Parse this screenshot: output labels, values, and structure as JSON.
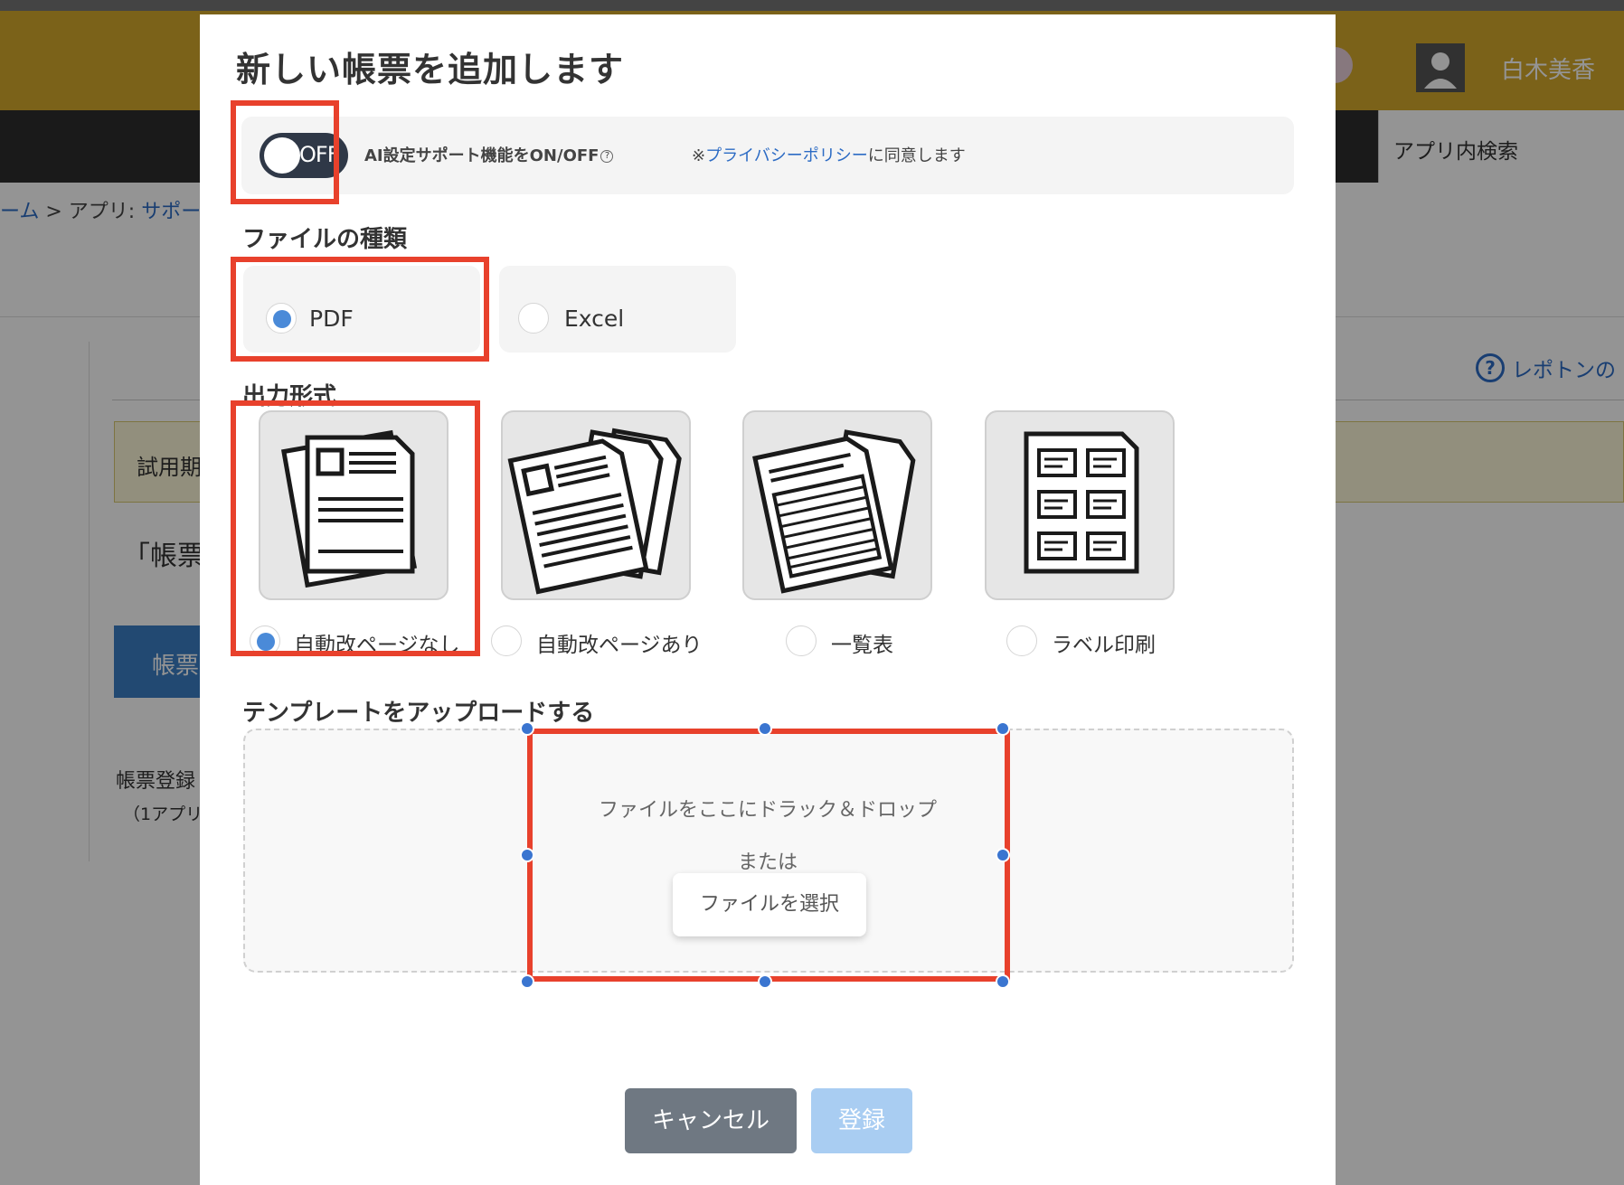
{
  "background": {
    "user_name": "白木美香",
    "search_label": "アプリ内検索",
    "breadcrumb_home": "ーム",
    "breadcrumb_sep": ">",
    "breadcrumb_app": "アプリ:",
    "breadcrumb_app_link": "サポー",
    "trial_text": "試用期",
    "reptone_link": "レポトンの",
    "bracket_text": "「帳票",
    "blue_button": "帳票",
    "reg_text": "帳票登録",
    "reg_sub": "（1アプリ"
  },
  "modal": {
    "title": "新しい帳票を追加します",
    "ai": {
      "toggle_state": "OFF",
      "label": "AI設定サポート機能をON/OFF",
      "help_icon": "?",
      "privacy_prefix": "※",
      "privacy_link": "プライバシーポリシー",
      "privacy_suffix": "に同意します"
    },
    "file_type": {
      "heading": "ファイルの種類",
      "options": [
        {
          "label": "PDF",
          "selected": true
        },
        {
          "label": "Excel",
          "selected": false
        }
      ]
    },
    "output_format": {
      "heading": "出力形式",
      "options": [
        {
          "label": "自動改ページなし",
          "icon": "single-document-icon",
          "selected": true
        },
        {
          "label": "自動改ページあり",
          "icon": "multi-document-icon",
          "selected": false
        },
        {
          "label": "一覧表",
          "icon": "list-document-icon",
          "selected": false
        },
        {
          "label": "ラベル印刷",
          "icon": "label-sheet-icon",
          "selected": false
        }
      ]
    },
    "upload": {
      "heading": "テンプレートをアップロードする",
      "drop_text": "ファイルをここにドラック＆ドロップ",
      "or_text": "または",
      "choose_button": "ファイルを選択"
    },
    "buttons": {
      "cancel": "キャンセル",
      "register": "登録"
    }
  },
  "colors": {
    "highlight": "#e8412c",
    "accent_blue": "#4a8ad8",
    "toggle_bg": "#2f3847",
    "header_gold": "#d4a92c"
  }
}
